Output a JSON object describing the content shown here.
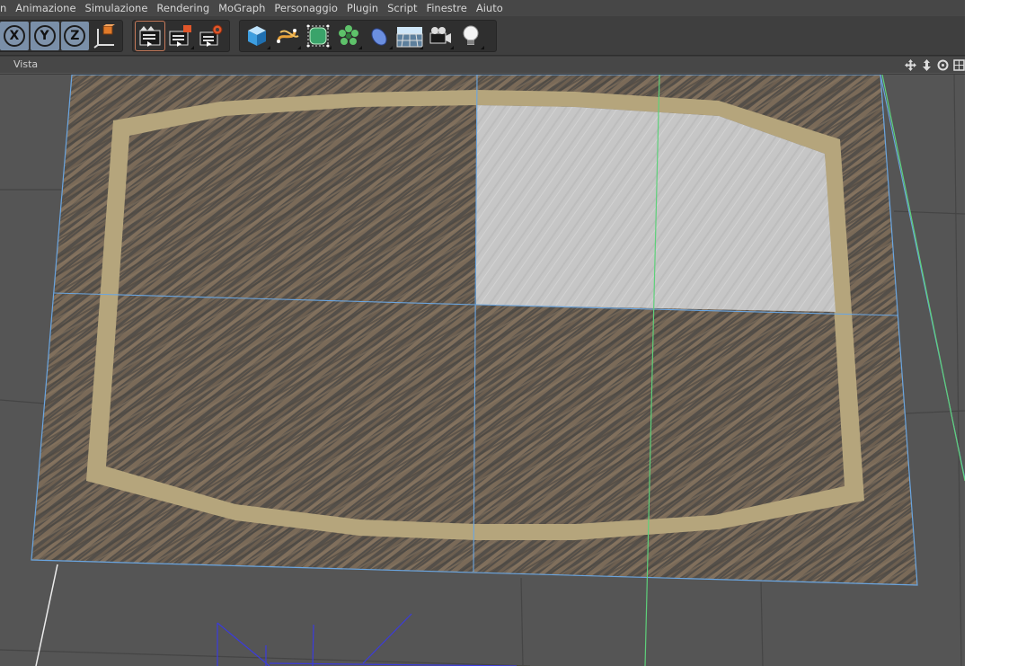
{
  "menu": [
    "n",
    "Animazione",
    "Simulazione",
    "Rendering",
    "MoGraph",
    "Personaggio",
    "Plugin",
    "Script",
    "Finestre",
    "Aiuto"
  ],
  "axis_buttons": [
    "X",
    "Y",
    "Z"
  ],
  "viewport": {
    "menu_label": "Vista",
    "nav_icons": [
      "move-view-icon",
      "zoom-view-icon",
      "rotate-view-icon",
      "toggle-layout-icon"
    ]
  },
  "toolbar_icons": {
    "coordinate": "world-coordinate-icon",
    "render_group": [
      "render-view-icon",
      "render-picture-viewer-icon",
      "render-settings-icon"
    ],
    "object_group": [
      "cube-icon",
      "spline-pen-icon",
      "subdivision-surface-icon",
      "cloner-icon",
      "deformer-icon",
      "floor-icon",
      "camera-icon",
      "light-icon"
    ]
  },
  "colors": {
    "wood_dark": "#4e4a45",
    "wood_light": "#7a6a58",
    "frame": "#b9a97f",
    "highlight": "#c8c8c8",
    "axis_active": "#7f93ab",
    "edge_blue": "#6aa5e0",
    "axis_green": "#5ed07a"
  }
}
